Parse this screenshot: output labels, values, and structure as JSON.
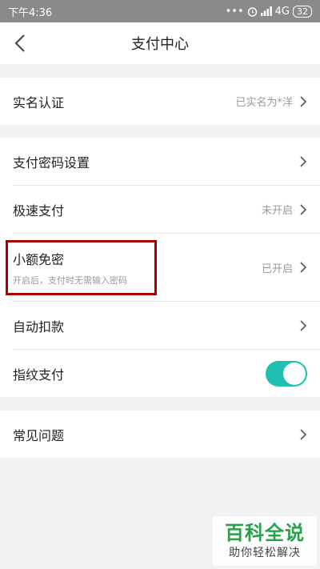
{
  "status_bar": {
    "time": "下午4:36",
    "dots": "•••",
    "network": "4G",
    "battery": "32"
  },
  "header": {
    "title": "支付中心"
  },
  "icons": {
    "back": "back-arrow-icon",
    "chevron": "chevron-right-icon",
    "alarm": "alarm-icon",
    "signal": "signal-icon"
  },
  "sections": {
    "real_name": {
      "label": "实名认证",
      "value": "已实名为*洋"
    },
    "pay_password": {
      "label": "支付密码设置"
    },
    "fast_pay": {
      "label": "极速支付",
      "value": "未开启"
    },
    "small_no_pwd": {
      "label": "小额免密",
      "sub": "开启后，支付时无需输入密码",
      "value": "已开启"
    },
    "auto_debit": {
      "label": "自动扣款"
    },
    "fingerprint": {
      "label": "指纹支付",
      "enabled": true
    },
    "faq": {
      "label": "常见问题"
    }
  },
  "colors": {
    "accent": "#1fbfb2",
    "highlight": "#a40000",
    "watermark_green": "#25a34a"
  },
  "watermark": {
    "title": "百科全说",
    "subtitle": "助你轻松解决"
  }
}
